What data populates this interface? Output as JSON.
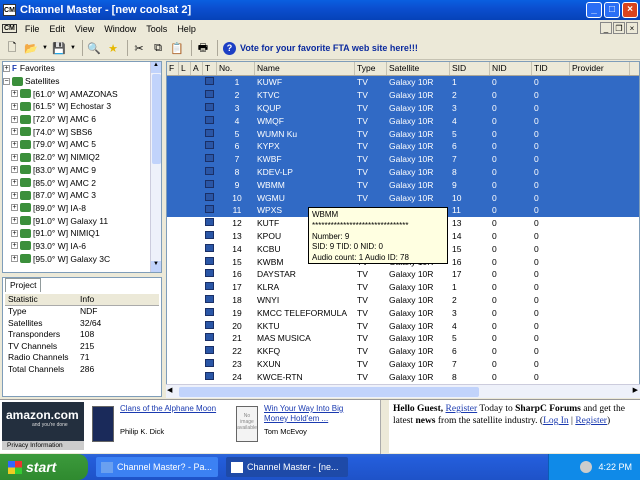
{
  "window": {
    "title": "Channel Master - [new coolsat 2]",
    "icon_text": "CM"
  },
  "menu": [
    "File",
    "Edit",
    "View",
    "Window",
    "Tools",
    "Help"
  ],
  "toolbar": {
    "vote_text": "Vote for your favorite FTA web site here!!!"
  },
  "tree": {
    "favorites": "Favorites",
    "satellites": "Satellites",
    "items": [
      "[61.0° W] AMAZONAS",
      "[61.5° W] Echostar 3",
      "[72.0° W] AMC 6",
      "[74.0° W] SBS6",
      "[79.0° W] AMC 5",
      "[82.0° W] NIMIQ2",
      "[83.0° W] AMC 9",
      "[85.0° W] AMC 2",
      "[87.0° W] AMC 3",
      "[89.0° W] IA-8",
      "[91.0° W] Galaxy 11",
      "[91.0° W] NIMIQ1",
      "[93.0° W] IA-6",
      "[95.0° W] Galaxy 3C"
    ]
  },
  "project": {
    "tab": "Project",
    "headers": [
      "Statistic",
      "Info"
    ],
    "rows": [
      [
        "Type",
        "NDF"
      ],
      [
        "Satellites",
        "32/64"
      ],
      [
        "Transponders",
        "108"
      ],
      [
        "TV Channels",
        "215"
      ],
      [
        "Radio Channels",
        "71"
      ],
      [
        "Total Channels",
        "286"
      ]
    ]
  },
  "list": {
    "headers": [
      "F",
      "L",
      "A",
      "T",
      "No.",
      "Name",
      "Type",
      "Satellite",
      "SID",
      "NID",
      "TID",
      "Provider"
    ],
    "rows": [
      {
        "no": "1",
        "name": "KUWF",
        "type": "TV",
        "sat": "Galaxy 10R",
        "sid": "1",
        "nid": "0",
        "tid": "0",
        "sel": true
      },
      {
        "no": "2",
        "name": "KTVC",
        "type": "TV",
        "sat": "Galaxy 10R",
        "sid": "2",
        "nid": "0",
        "tid": "0",
        "sel": true
      },
      {
        "no": "3",
        "name": "KQUP",
        "type": "TV",
        "sat": "Galaxy 10R",
        "sid": "3",
        "nid": "0",
        "tid": "0",
        "sel": true
      },
      {
        "no": "4",
        "name": "WMQF",
        "type": "TV",
        "sat": "Galaxy 10R",
        "sid": "4",
        "nid": "0",
        "tid": "0",
        "sel": true
      },
      {
        "no": "5",
        "name": "WUMN Ku",
        "type": "TV",
        "sat": "Galaxy 10R",
        "sid": "5",
        "nid": "0",
        "tid": "0",
        "sel": true
      },
      {
        "no": "6",
        "name": "KYPX",
        "type": "TV",
        "sat": "Galaxy 10R",
        "sid": "6",
        "nid": "0",
        "tid": "0",
        "sel": true
      },
      {
        "no": "7",
        "name": "KWBF",
        "type": "TV",
        "sat": "Galaxy 10R",
        "sid": "7",
        "nid": "0",
        "tid": "0",
        "sel": true
      },
      {
        "no": "8",
        "name": "KDEV-LP",
        "type": "TV",
        "sat": "Galaxy 10R",
        "sid": "8",
        "nid": "0",
        "tid": "0",
        "sel": true
      },
      {
        "no": "9",
        "name": "WBMM",
        "type": "TV",
        "sat": "Galaxy 10R",
        "sid": "9",
        "nid": "0",
        "tid": "0",
        "sel": true
      },
      {
        "no": "10",
        "name": "WGMU",
        "type": "TV",
        "sat": "Galaxy 10R",
        "sid": "10",
        "nid": "0",
        "tid": "0",
        "sel": true
      },
      {
        "no": "11",
        "name": "WPXS",
        "type": "TV",
        "sat": "Galaxy 10R",
        "sid": "11",
        "nid": "0",
        "tid": "0",
        "sel": true
      },
      {
        "no": "12",
        "name": "KUTF",
        "type": "TV",
        "sat": "Galaxy 10R",
        "sid": "13",
        "nid": "0",
        "tid": "0",
        "sel": false
      },
      {
        "no": "13",
        "name": "KPOU",
        "type": "TV",
        "sat": "Galaxy 10R",
        "sid": "14",
        "nid": "0",
        "tid": "0",
        "sel": false
      },
      {
        "no": "14",
        "name": "KCBU",
        "type": "TV",
        "sat": "Galaxy 10R",
        "sid": "15",
        "nid": "0",
        "tid": "0",
        "sel": false
      },
      {
        "no": "15",
        "name": "KWBM",
        "type": "TV",
        "sat": "Galaxy 10R",
        "sid": "16",
        "nid": "0",
        "tid": "0",
        "sel": false
      },
      {
        "no": "16",
        "name": "DAYSTAR",
        "type": "TV",
        "sat": "Galaxy 10R",
        "sid": "17",
        "nid": "0",
        "tid": "0",
        "sel": false
      },
      {
        "no": "17",
        "name": "KLRA",
        "type": "TV",
        "sat": "Galaxy 10R",
        "sid": "1",
        "nid": "0",
        "tid": "0",
        "sel": false
      },
      {
        "no": "18",
        "name": "WNYI",
        "type": "TV",
        "sat": "Galaxy 10R",
        "sid": "2",
        "nid": "0",
        "tid": "0",
        "sel": false
      },
      {
        "no": "19",
        "name": "KMCC TELEFORMULA",
        "type": "TV",
        "sat": "Galaxy 10R",
        "sid": "3",
        "nid": "0",
        "tid": "0",
        "sel": false
      },
      {
        "no": "20",
        "name": "KKTU",
        "type": "TV",
        "sat": "Galaxy 10R",
        "sid": "4",
        "nid": "0",
        "tid": "0",
        "sel": false
      },
      {
        "no": "21",
        "name": "MAS MUSICA",
        "type": "TV",
        "sat": "Galaxy 10R",
        "sid": "5",
        "nid": "0",
        "tid": "0",
        "sel": false
      },
      {
        "no": "22",
        "name": "KKFQ",
        "type": "TV",
        "sat": "Galaxy 10R",
        "sid": "6",
        "nid": "0",
        "tid": "0",
        "sel": false
      },
      {
        "no": "23",
        "name": "KXUN",
        "type": "TV",
        "sat": "Galaxy 10R",
        "sid": "7",
        "nid": "0",
        "tid": "0",
        "sel": false
      },
      {
        "no": "24",
        "name": "KWCE-RTN",
        "type": "TV",
        "sat": "Galaxy 10R",
        "sid": "8",
        "nid": "0",
        "tid": "0",
        "sel": false
      }
    ]
  },
  "tooltip": {
    "lines": [
      "WBMM",
      "*******************************",
      "Number: 9",
      "SID: 9  TID: 0   NID: 0",
      "Audio count: 1  Audio ID: 78"
    ]
  },
  "ads": {
    "amazon_logo": "amazon.com",
    "amazon_tag": "and you're done",
    "privacy": "Privacy Information",
    "book1": {
      "title": "Clans of the Alphane Moon",
      "author": "Philip K. Dick"
    },
    "book2": {
      "title": "Win Your Way Into Big Money Hold'em ...",
      "author": "Tom McEvoy",
      "noimg": "No image available"
    },
    "forum": {
      "hello": "Hello Guest,",
      "register": "Register",
      "today": " Today to ",
      "brand": "SharpC Forums",
      "and": " and get the latest ",
      "news": "news",
      "rest": " from the satellite industry. (",
      "login": "Log In",
      "sep": " | ",
      "register2": "Register",
      "close": ")"
    }
  },
  "taskbar": {
    "start": "start",
    "tasks": [
      "Channel Master? - Pa...",
      "Channel Master - [ne..."
    ],
    "clock": "4:22 PM"
  }
}
